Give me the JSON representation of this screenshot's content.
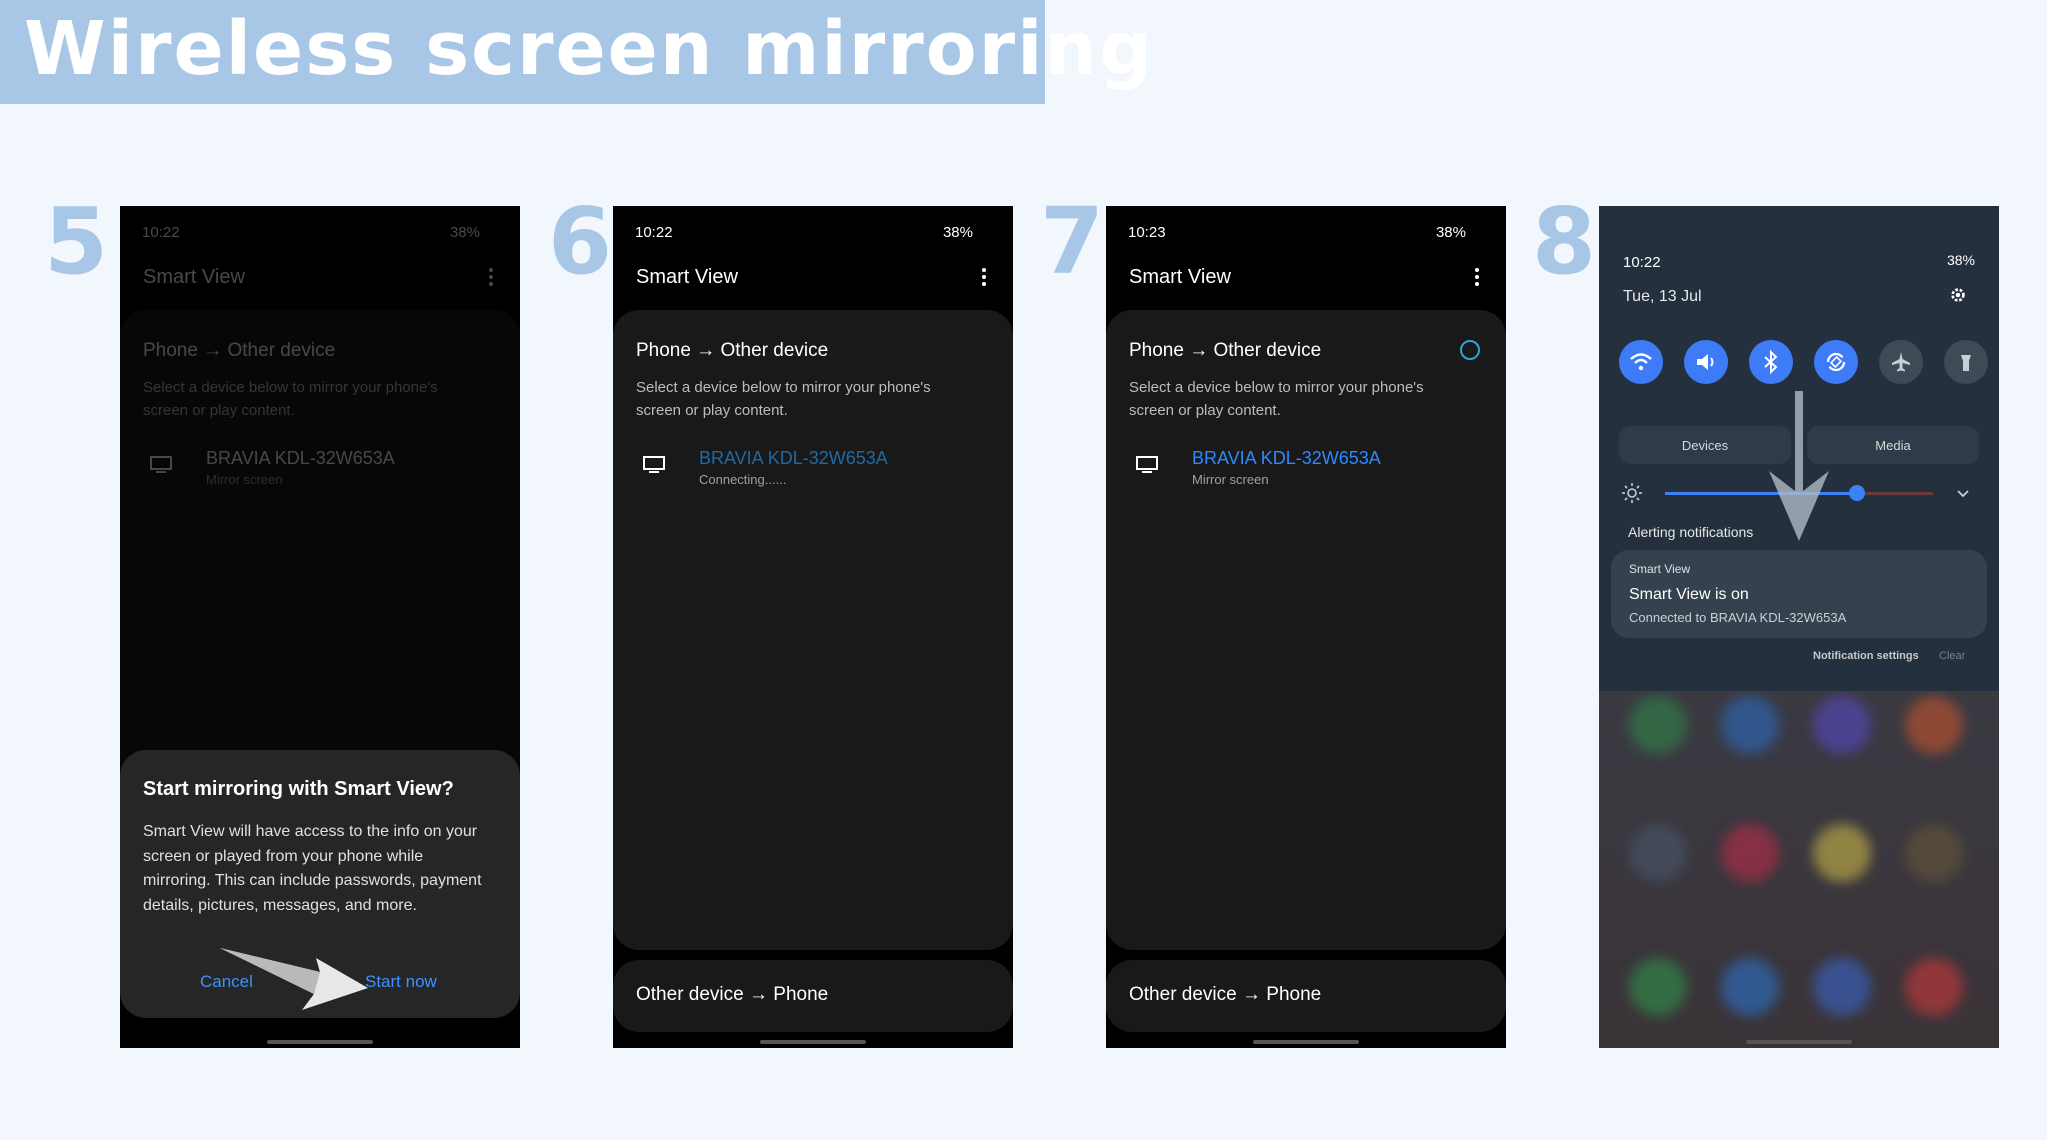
{
  "title": "Wireless screen mirroring",
  "steps": [
    {
      "number": "5",
      "time": "10:22",
      "status": "38%",
      "app_title": "Smart View",
      "section_title": "Phone → Other device",
      "section_desc": "Select a device below to mirror your phone's screen or play content.",
      "device_name": "BRAVIA KDL-32W653A",
      "device_status": "Mirror screen",
      "dialog": {
        "title": "Start mirroring with Smart View?",
        "body": "Smart View will have access to the info on your screen or played from your phone while mirroring. This can include passwords, payment details, pictures, messages, and more.",
        "cancel": "Cancel",
        "confirm": "Start now"
      }
    },
    {
      "number": "6",
      "time": "10:22",
      "status": "38%",
      "app_title": "Smart View",
      "section_title": "Phone → Other device",
      "section_desc": "Select a device below to mirror your phone's screen or play content.",
      "device_name": "BRAVIA KDL-32W653A",
      "device_status": "Connecting......",
      "bottom_section": "Other device → Phone"
    },
    {
      "number": "7",
      "time": "10:23",
      "status": "38%",
      "app_title": "Smart View",
      "section_title": "Phone → Other device",
      "section_desc": "Select a device below to mirror your phone's screen or play content.",
      "device_name": "BRAVIA KDL-32W653A",
      "device_status": "Mirror screen",
      "bottom_section": "Other device → Phone"
    },
    {
      "number": "8",
      "time": "10:22",
      "status": "38%",
      "date": "Tue, 13 Jul",
      "tabs": [
        "Devices",
        "Media"
      ],
      "alerting_label": "Alerting notifications",
      "notification": {
        "app": "Smart View",
        "title": "Smart View is on",
        "subtitle": "Connected to BRAVIA KDL-32W653A"
      },
      "notification_settings": "Notification settings",
      "clear": "Clear",
      "brightness_percent": 70
    }
  ],
  "colors": {
    "accent": "#3e91ff",
    "banner": "#a8c7e6",
    "background": "#f2f7fd"
  }
}
